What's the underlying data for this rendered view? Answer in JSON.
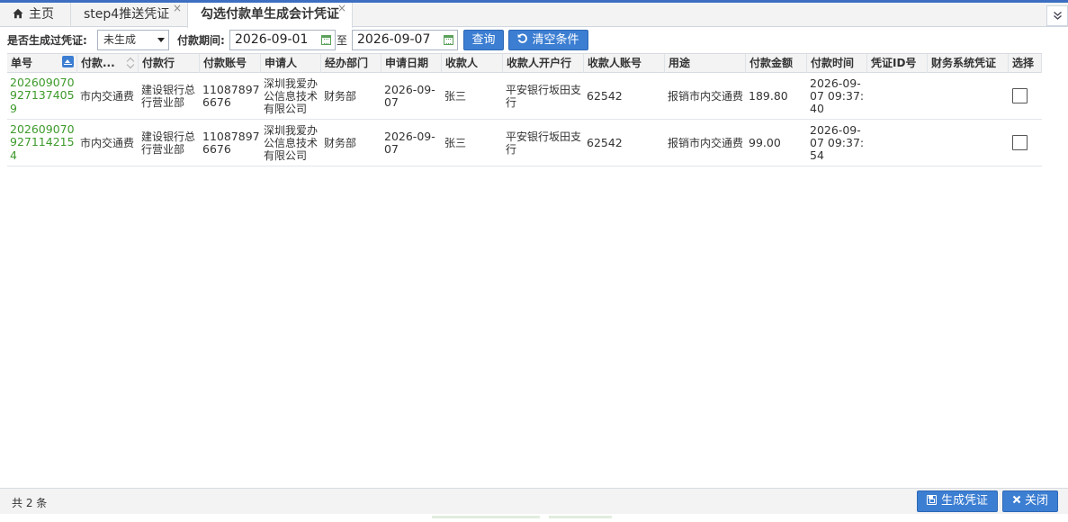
{
  "tabs": {
    "home": "主页",
    "tab1": "step4推送凭证",
    "tab2": "勾选付款单生成会计凭证",
    "close_glyph": "×",
    "more_glyph": "»"
  },
  "filter": {
    "generated_label": "是否生成过凭证:",
    "generated_value": "未生成",
    "period_label": "付款期间:",
    "date_from": "2026-09-01",
    "to_label": "至",
    "date_to": "2026-09-07",
    "query_button": "查询",
    "clear_button": "清空条件"
  },
  "table": {
    "columns": [
      "单号",
      "付款...",
      "付款行",
      "付款账号",
      "申请人",
      "经办部门",
      "申请日期",
      "收款人",
      "收款人开户行",
      "收款人账号",
      "用途",
      "付款金额",
      "付款时间",
      "凭证ID号",
      "财务系统凭证",
      "选择"
    ],
    "rows": [
      {
        "no": "2026090709271374059",
        "pay_type": "市内交通费",
        "pay_bank": "建设银行总行营业部",
        "pay_account": "110878976676",
        "applicant": "深圳我爱办公信息技术有限公司",
        "dept": "财务部",
        "apply_date": "2026-09-07",
        "payee": "张三",
        "payee_bank": "平安银行坂田支行",
        "payee_account": "62542",
        "purpose": "报销市内交通费",
        "amount": "189.80",
        "pay_time": "2026-09-07 09:37:40",
        "voucher_id": "",
        "fin_voucher": ""
      },
      {
        "no": "2026090709271142154",
        "pay_type": "市内交通费",
        "pay_bank": "建设银行总行营业部",
        "pay_account": "110878976676",
        "applicant": "深圳我爱办公信息技术有限公司",
        "dept": "财务部",
        "apply_date": "2026-09-07",
        "payee": "张三",
        "payee_bank": "平安银行坂田支行",
        "payee_account": "62542",
        "purpose": "报销市内交通费",
        "amount": "99.00",
        "pay_time": "2026-09-07 09:37:54",
        "voucher_id": "",
        "fin_voucher": ""
      }
    ]
  },
  "footer": {
    "count": "共 2 条",
    "generate_button": "生成凭证",
    "close_button": "关闭"
  },
  "colors": {
    "accent": "#3c7ed2",
    "code_green": "#3c9a2a",
    "calendar_green": "#5aa05a"
  }
}
